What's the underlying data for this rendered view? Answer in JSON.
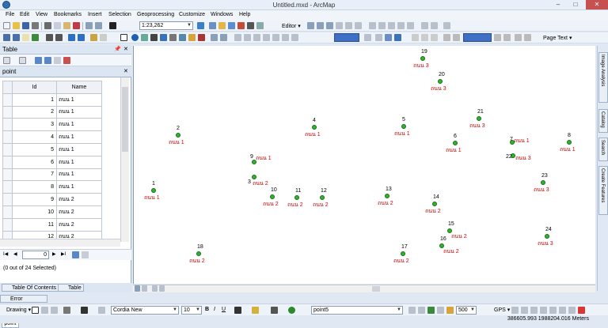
{
  "window": {
    "title": "Untitled.mxd - ArcMap",
    "minimize": "–",
    "maximize": "□",
    "close": "✕"
  },
  "menu": [
    "File",
    "Edit",
    "View",
    "Bookmarks",
    "Insert",
    "Selection",
    "Geoprocessing",
    "Customize",
    "Windows",
    "Help"
  ],
  "toolbar": {
    "scale": "1:23,262",
    "editor": "Editor ▾",
    "target_layer": "Layer",
    "page_text": "Page Text ▾"
  },
  "panel": {
    "title": "Table",
    "layer_tab": "point",
    "pin": "📌",
    "close": "✕"
  },
  "table": {
    "columns": [
      "Id",
      "Name"
    ],
    "rows": [
      {
        "id": "1",
        "name": "ถนน 1"
      },
      {
        "id": "2",
        "name": "ถนน 1"
      },
      {
        "id": "3",
        "name": "ถนน 1"
      },
      {
        "id": "4",
        "name": "ถนน 1"
      },
      {
        "id": "5",
        "name": "ถนน 1"
      },
      {
        "id": "6",
        "name": "ถนน 1"
      },
      {
        "id": "7",
        "name": "ถนน 1"
      },
      {
        "id": "8",
        "name": "ถนน 1"
      },
      {
        "id": "9",
        "name": "ถนน 2"
      },
      {
        "id": "10",
        "name": "ถนน 2"
      },
      {
        "id": "11",
        "name": "ถนน 2"
      },
      {
        "id": "12",
        "name": "ถนน 2"
      }
    ]
  },
  "nav": {
    "record": "0",
    "first": "I◀",
    "prev": "◀",
    "next": "▶",
    "last": "▶I"
  },
  "selection": "(0 out of 24 Selected)",
  "bottom_tab": "point",
  "tabs": {
    "toc": "Table Of Contents",
    "table": "Table",
    "error": "Error Inspector"
  },
  "right_tabs": [
    "Image Analysis",
    "Catalog",
    "Search",
    "Create Features"
  ],
  "points": [
    {
      "n": "19",
      "name": "ถนน 3"
    },
    {
      "n": "20",
      "name": "ถนน 3"
    },
    {
      "n": "21",
      "name": "ถนน 3"
    },
    {
      "n": "2",
      "name": "ถนน 1"
    },
    {
      "n": "4",
      "name": "ถนน 1"
    },
    {
      "n": "5",
      "name": "ถนน 1"
    },
    {
      "n": "6",
      "name": "ถนน 1"
    },
    {
      "n": "7",
      "name": "ถนน 1"
    },
    {
      "n": "8",
      "name": "ถนน 1"
    },
    {
      "n": "22",
      "name": "ถนน 3"
    },
    {
      "n": "9",
      "name": "ถนน 1"
    },
    {
      "n": "3",
      "name": "ถนน 2"
    },
    {
      "n": "1",
      "name": "ถนน 1"
    },
    {
      "n": "10",
      "name": "ถนน 2"
    },
    {
      "n": "11",
      "name": "ถนน 2"
    },
    {
      "n": "12",
      "name": "ถนน 2"
    },
    {
      "n": "13",
      "name": "ถนน 2"
    },
    {
      "n": "14",
      "name": "ถนน 2"
    },
    {
      "n": "23",
      "name": "ถนน 3"
    },
    {
      "n": "15",
      "name": "ถนน 2"
    },
    {
      "n": "16",
      "name": "ถนน 2"
    },
    {
      "n": "24",
      "name": "ถนน 3"
    },
    {
      "n": "18",
      "name": "ถนน 2"
    },
    {
      "n": "17",
      "name": "ถนน 2"
    }
  ],
  "drawing": {
    "label": "Drawing ▾",
    "font": "Cordia New",
    "size": "10",
    "bold": "B",
    "italic": "I",
    "underline": "U",
    "layer": "point5",
    "width": "500",
    "gps": "GPS ▾"
  },
  "status": {
    "coords": "386605.993  1988204.016 Meters"
  },
  "colors": {
    "point": "#2db52d",
    "label": "#d40000"
  }
}
